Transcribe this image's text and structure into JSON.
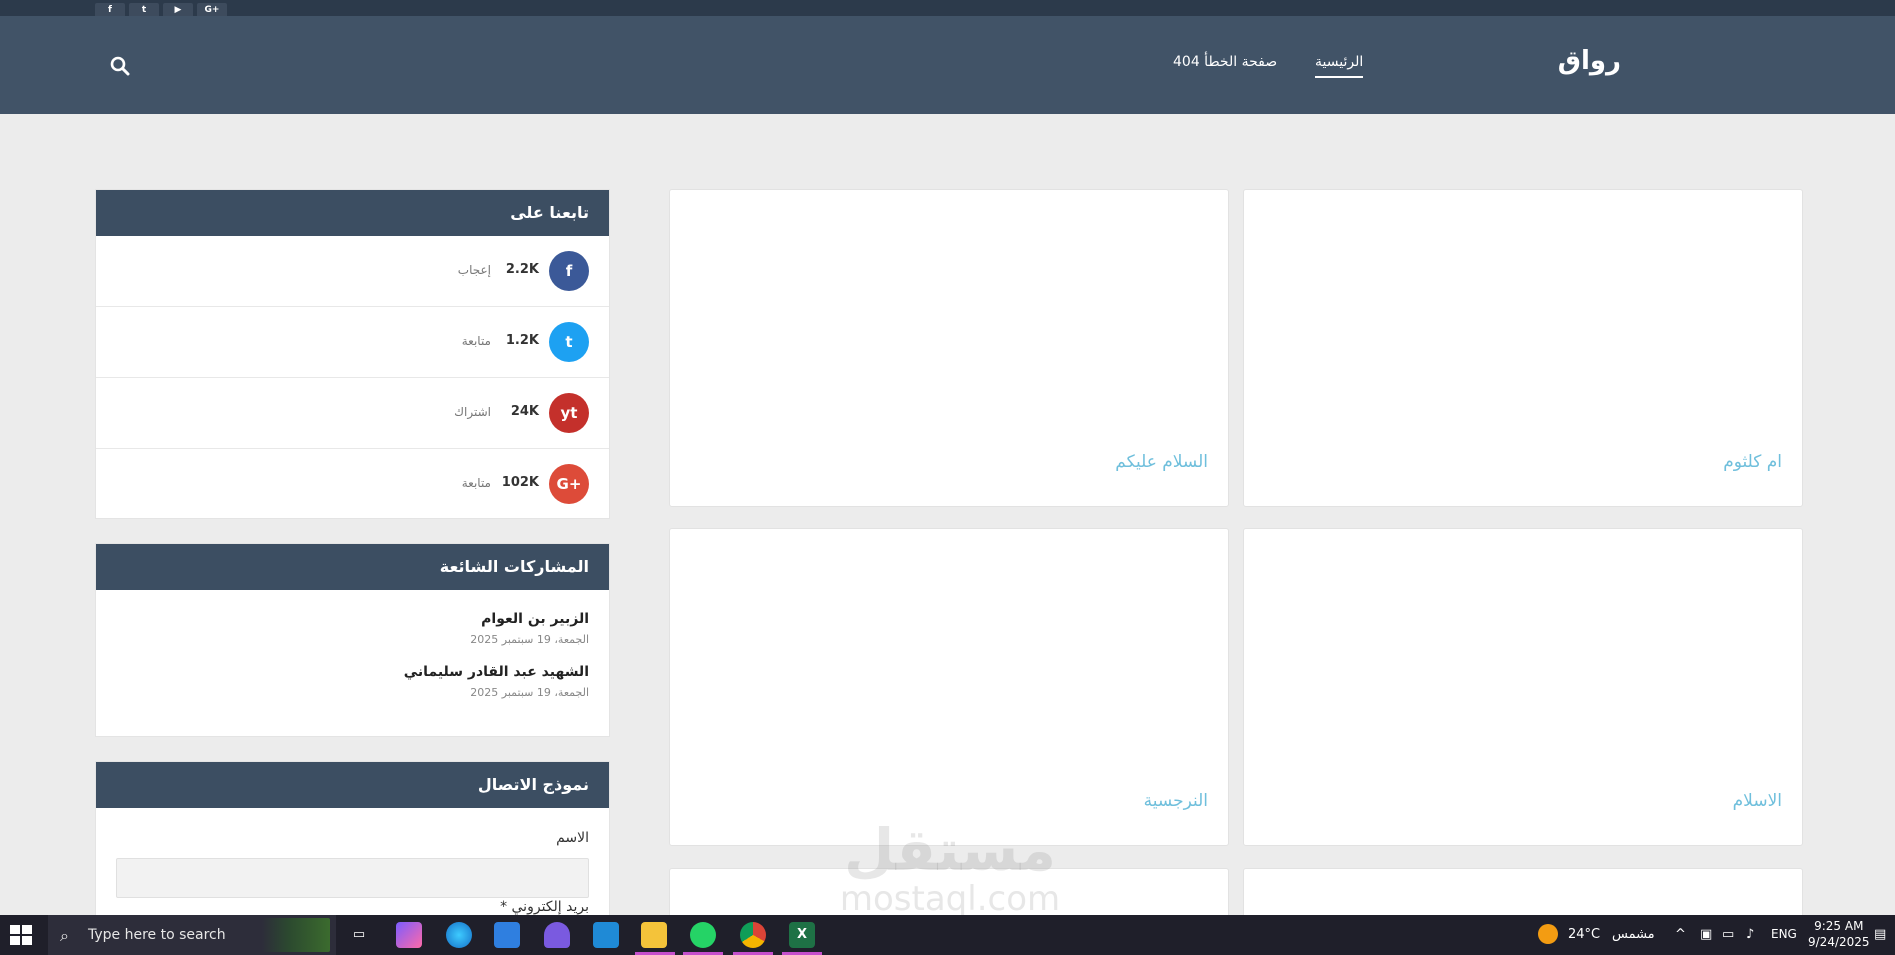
{
  "header": {
    "logo": "رواق",
    "nav": {
      "home": "الرئيسية",
      "error_page": "صفحة الخطأ 404"
    },
    "top_social_icons": [
      "f",
      "t",
      "yt",
      "G+"
    ]
  },
  "posts": [
    {
      "title": "ام كلثوم"
    },
    {
      "title": "السلام عليكم"
    },
    {
      "title": "الاسلام"
    },
    {
      "title": "النرجسية"
    }
  ],
  "follow_widget": {
    "title": "تابعنا على",
    "items": [
      {
        "icon": "f",
        "count": "2.2K",
        "label": "إعجاب",
        "color": "#3b5998"
      },
      {
        "icon": "t",
        "count": "1.2K",
        "label": "متابعة",
        "color": "#1da1f2"
      },
      {
        "icon": "yt",
        "count": "24K",
        "label": "اشتراك",
        "color": "#c4302b"
      },
      {
        "icon": "G+",
        "count": "102K",
        "label": "متابعة",
        "color": "#dd4b39"
      }
    ]
  },
  "popular_widget": {
    "title": "المشاركات الشائعة",
    "items": [
      {
        "title": "الزبير بن العوام",
        "date": "الجمعة، 19 سبتمبر 2025"
      },
      {
        "title": "الشهيد عبد القادر سليماني",
        "date": "الجمعة، 19 سبتمبر 2025"
      }
    ]
  },
  "contact_widget": {
    "title": "نموذج الاتصال",
    "name_label": "الاسم",
    "email_label": "بريد إلكتروني *"
  },
  "watermark": {
    "line1": "مستقل",
    "line2": "mostaql.com"
  },
  "taskbar": {
    "search_placeholder": "Type here to search",
    "weather_temp": "24°C",
    "weather_text": "مشمس",
    "language": "ENG",
    "time": "9:25 AM",
    "date": "9/24/2025"
  }
}
